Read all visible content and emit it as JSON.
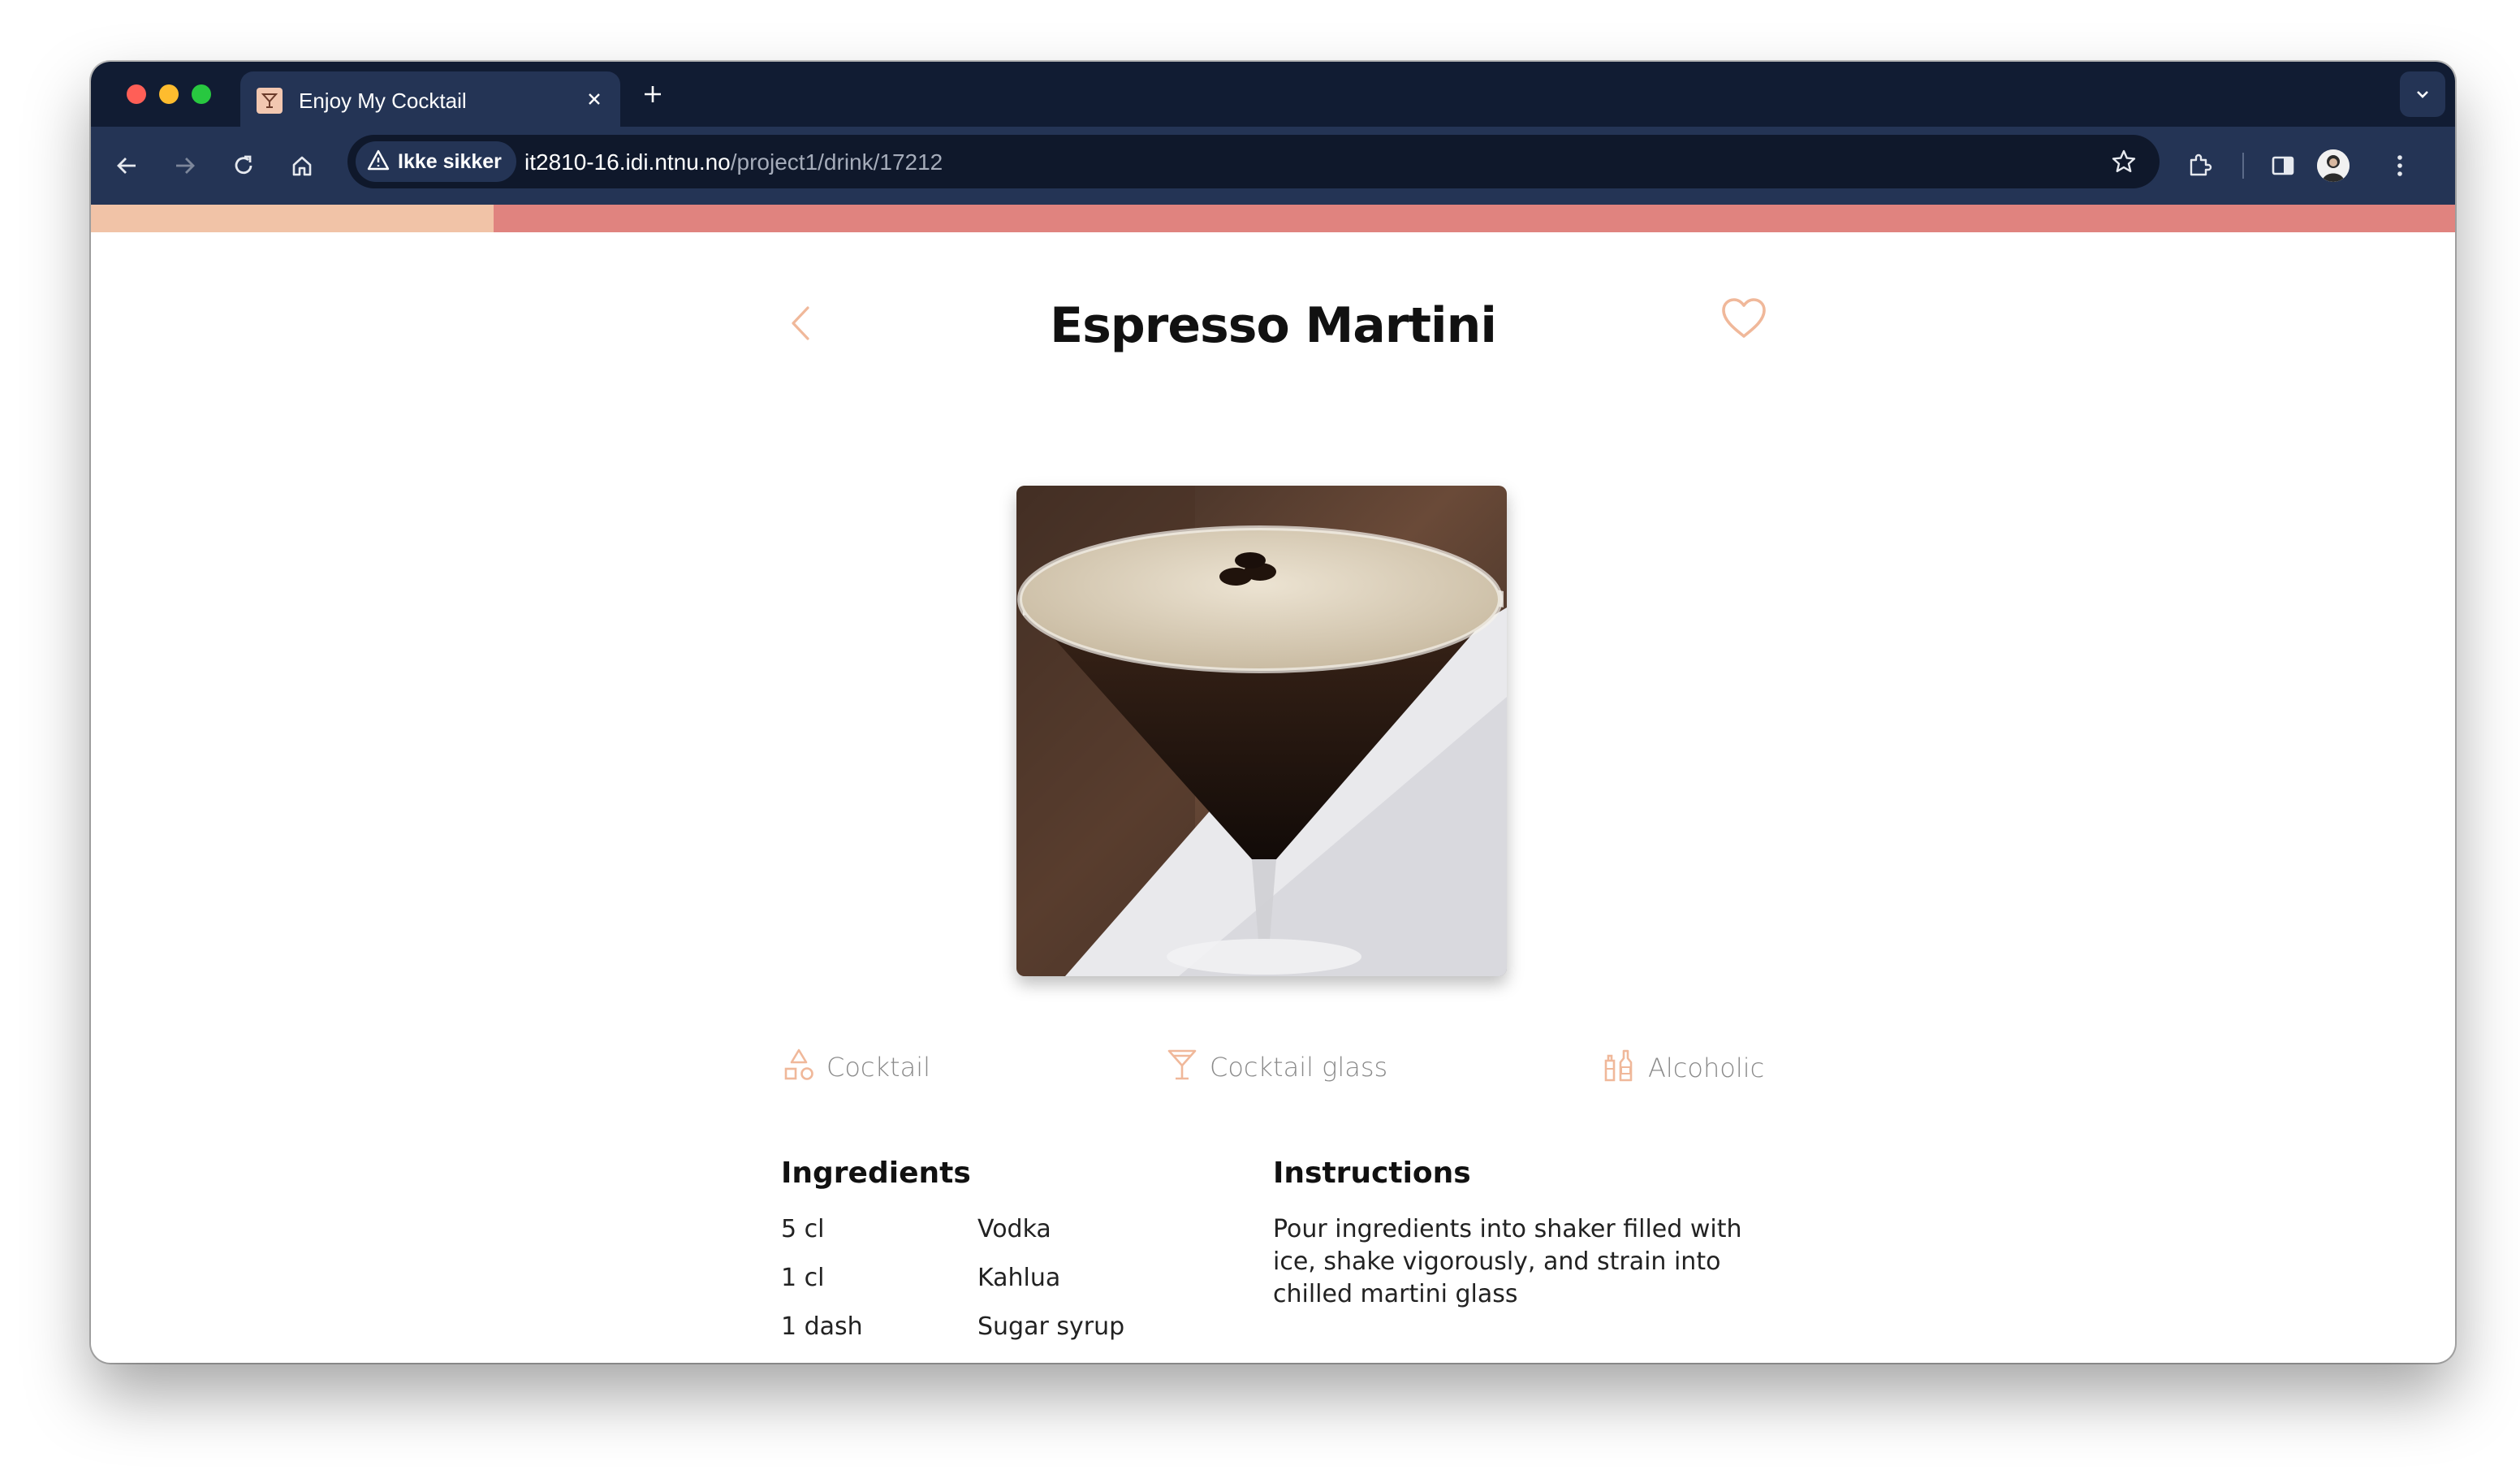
{
  "browser": {
    "tab": {
      "title": "Enjoy My Cocktail",
      "favicon": "cocktail-favicon-icon"
    },
    "address": {
      "security_label": "Ikke sikker",
      "host": "it2810-16.idi.ntnu.no",
      "path": "/project1/drink/17212"
    },
    "icons": [
      "back-icon",
      "forward-icon",
      "reload-icon",
      "home-icon",
      "warning-icon",
      "star-icon",
      "extensions-icon",
      "side-panel-icon",
      "profile-avatar",
      "menu-icon",
      "tab-search-icon",
      "close-icon",
      "plus-icon"
    ]
  },
  "colors": {
    "accent": "#f1c3a7",
    "band": "#e0837f",
    "icon_accent": "#f0b89a",
    "chrome_dark": "#111c33",
    "chrome_toolbar": "#243455"
  },
  "drink": {
    "name": "Espresso Martini",
    "category": "Cocktail",
    "glass": "Cocktail glass",
    "alcoholic": "Alcoholic",
    "ingredients_title": "Ingredients",
    "ingredients": [
      {
        "measure": "5 cl",
        "name": "Vodka"
      },
      {
        "measure": "1 cl",
        "name": "Kahlua"
      },
      {
        "measure": "1 dash",
        "name": "Sugar syrup"
      }
    ],
    "instructions_title": "Instructions",
    "instructions": "Pour ingredients into shaker filled with ice, shake vigorously, and strain into chilled martini glass"
  }
}
